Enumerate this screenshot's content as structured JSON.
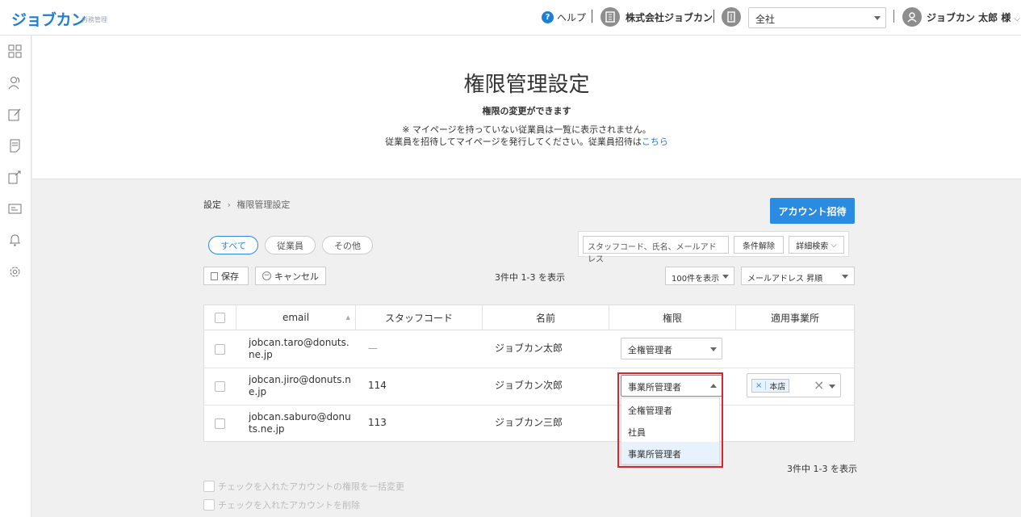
{
  "header": {
    "logo": "ジョブカン",
    "logo_sub": "労務管理",
    "help": "ヘルプ",
    "company": "株式会社ジョブカン",
    "office_select": "全社",
    "user": "ジョブカン 太郎 様"
  },
  "page": {
    "title": "権限管理設定",
    "subtitle": "権限の変更ができます",
    "note1": "※ マイページを持っていない従業員は一覧に表示されません。",
    "note2": "従業員を招待してマイページを発行してください。従業員招待は",
    "note2_link": "こちら"
  },
  "breadcrumb": {
    "parent": "設定",
    "separator": "›",
    "current": "権限管理設定"
  },
  "toolbar": {
    "invite": "アカウント招待",
    "filters": [
      "すべて",
      "従業員",
      "その他"
    ],
    "search_placeholder": "スタッフコード、氏名、メールアドレス",
    "clear": "条件解除",
    "advanced": "詳細検索",
    "save": "保存",
    "cancel": "キャンセル",
    "count": "3件中 1-3 を表示",
    "per_page": "100件を表示",
    "sort": "メールアドレス 昇順"
  },
  "table": {
    "columns": [
      "email",
      "スタッフコード",
      "名前",
      "権限",
      "適用事業所"
    ],
    "rows": [
      {
        "email_l1": "jobcan.taro@donuts.",
        "email_l2": "ne.jp",
        "code": "—",
        "name": "ジョブカン太郎",
        "role": "全権管理者",
        "office": ""
      },
      {
        "email_l1": "jobcan.jiro@donuts.n",
        "email_l2": "e.jp",
        "code": "114",
        "name": "ジョブカン次郎",
        "role": "事業所管理者",
        "office": "本店"
      },
      {
        "email_l1": "jobcan.saburo@donu",
        "email_l2": "ts.ne.jp",
        "code": "113",
        "name": "ジョブカン三郎",
        "role": "",
        "office": ""
      }
    ]
  },
  "role_dropdown": {
    "options": [
      "全権管理者",
      "社員",
      "事業所管理者"
    ],
    "selected": "事業所管理者"
  },
  "footer": {
    "count": "3件中 1-3 を表示",
    "bulk_change": "チェックを入れたアカウントの権限を一括変更",
    "bulk_delete": "チェックを入れたアカウントを削除"
  },
  "colors": {
    "accent": "#2b8be0",
    "highlight_frame": "#d9262b",
    "selected_option": "#e7f2fc"
  }
}
